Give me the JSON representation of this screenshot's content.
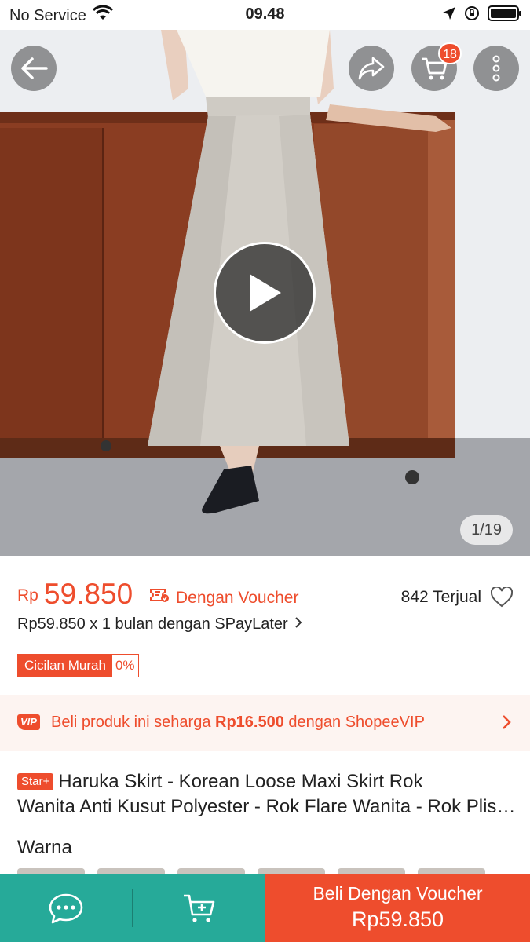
{
  "status_bar": {
    "carrier": "No Service",
    "time": "09.48"
  },
  "gallery": {
    "cart_badge": "18",
    "counter": "1/19"
  },
  "price": {
    "currency": "Rp",
    "amount": "59.850",
    "voucher_label": "Dengan Voucher",
    "sold": "842 Terjual",
    "paylater": "Rp59.850 x 1 bulan dengan SPayLater",
    "cicilan_label": "Cicilan Murah",
    "cicilan_pct": "0%"
  },
  "vip": {
    "badge": "VIP",
    "text_before": "Beli produk ini seharga ",
    "amount": "Rp16.500",
    "text_after": " dengan ShopeeVIP"
  },
  "product": {
    "badge": "Star+",
    "title_line1": "Haruka Skirt - Korean Loose Maxi Skirt Rok",
    "title_line2": "Wanita Anti Kusut Polyester - Rok Flare Wanita - Rok Plisket"
  },
  "variation": {
    "label": "Warna"
  },
  "bottom_bar": {
    "buy_label": "Beli Dengan Voucher",
    "buy_price": "Rp59.850"
  },
  "colors": {
    "brand": "#ee4d2d",
    "green": "#26aa99"
  }
}
